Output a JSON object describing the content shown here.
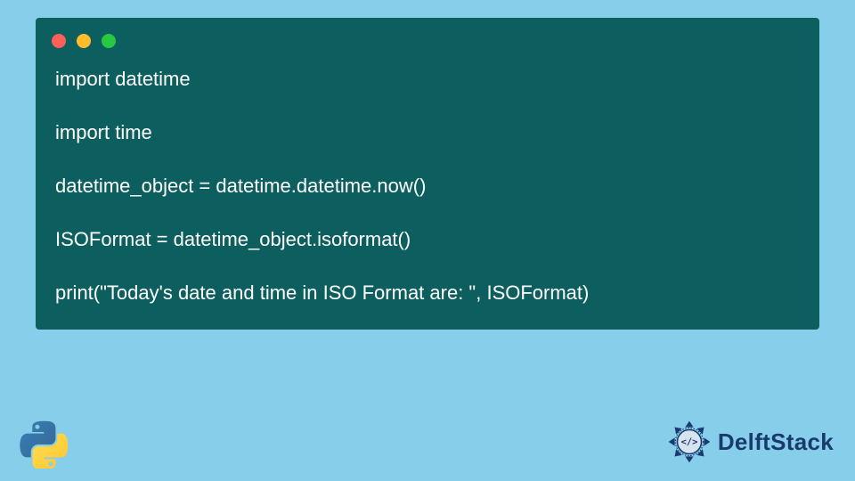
{
  "code": {
    "lines": [
      "import datetime",
      "",
      "import time",
      "",
      "datetime_object = datetime.datetime.now()",
      "",
      "ISOFormat = datetime_object.isoformat()",
      "",
      "print(\"Today's date and time in ISO Format are: \", ISOFormat)"
    ]
  },
  "brand": {
    "name": "DelftStack"
  },
  "colors": {
    "page_bg": "#87ceeb",
    "window_bg": "#0d5f5f",
    "code_text": "#ffffff",
    "traffic_red": "#ff5f56",
    "traffic_yellow": "#ffbd2e",
    "traffic_green": "#27c93f",
    "brand_text": "#1a3a6e"
  },
  "icons": {
    "python": "python-logo",
    "delft": "delft-emblem"
  }
}
